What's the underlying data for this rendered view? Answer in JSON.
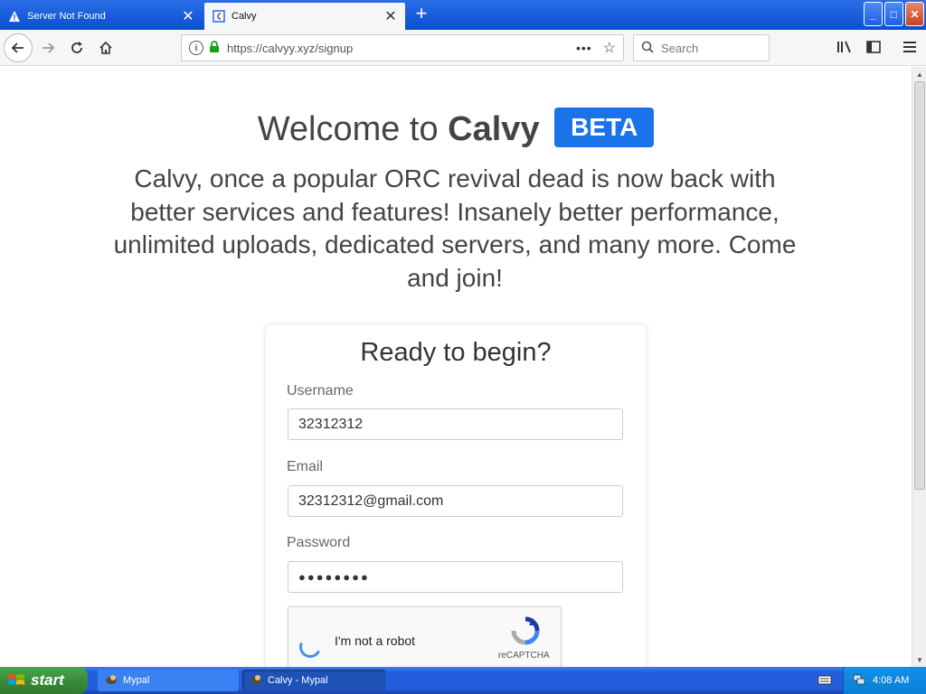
{
  "browser": {
    "tabs": [
      {
        "label": "Server Not Found",
        "icon": "warning-icon",
        "close": "✕"
      },
      {
        "label": "Calvy",
        "icon": "calvy-favicon",
        "close": "✕"
      }
    ],
    "newtab": "+",
    "window": {
      "minimize": "_",
      "maximize": "□",
      "close": "✕"
    },
    "url": "https://calvyy.xyz/signup",
    "search_placeholder": "Search"
  },
  "page": {
    "welcome_prefix": "Welcome to ",
    "brand": "Calvy",
    "badge": "BETA",
    "tagline": "Calvy, once a popular ORC revival dead is now back with better services and features! Insanely better performance, unlimited uploads, dedicated servers, and many more. Come and join!",
    "form": {
      "title": "Ready to begin?",
      "username_label": "Username",
      "username_value": "32312312",
      "email_label": "Email",
      "email_value": "32312312@gmail.com",
      "password_label": "Password",
      "password_value": "●●●●●●●●",
      "captcha_text": "I'm not a robot",
      "captcha_brand": "reCAPTCHA"
    }
  },
  "taskbar": {
    "start": "start",
    "items": [
      {
        "label": "Mypal"
      },
      {
        "label": "Calvy - Mypal"
      }
    ],
    "clock": "4:08 AM"
  },
  "colors": {
    "accent": "#1a73e8",
    "titlebar": "#0a4fd0",
    "taskbar": "#245edc",
    "start": "#3a8c3a"
  }
}
